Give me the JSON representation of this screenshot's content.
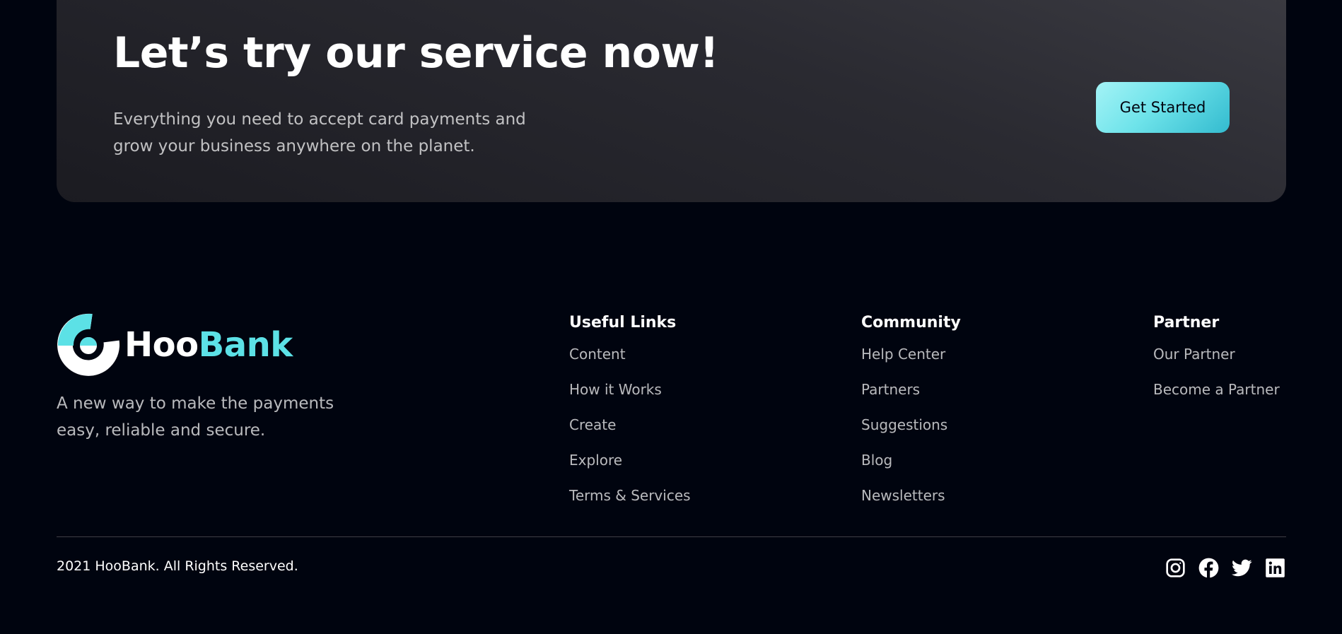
{
  "cta": {
    "title": "Let’s try our service now!",
    "text": "Everything you need to accept card payments and grow your business anywhere on the planet.",
    "button_label": "Get Started"
  },
  "brand": {
    "name_part1": "Hoo",
    "name_part2": "Bank",
    "logo_icon": "hoobank-logo-icon",
    "tagline": "A new way to make the payments easy, reliable and secure."
  },
  "footer_links": [
    {
      "title": "Useful Links",
      "links": [
        "Content",
        "How it Works",
        "Create",
        "Explore",
        "Terms & Services"
      ]
    },
    {
      "title": "Community",
      "links": [
        "Help Center",
        "Partners",
        "Suggestions",
        "Blog",
        "Newsletters"
      ]
    },
    {
      "title": "Partner",
      "links": [
        "Our Partner",
        "Become a Partner"
      ]
    }
  ],
  "bottom": {
    "copyright": "2021 HooBank. All Rights Reserved.",
    "socials": [
      "instagram-icon",
      "facebook-icon",
      "twitter-icon",
      "linkedin-icon"
    ]
  },
  "colors": {
    "background": "#00040f",
    "accent": "#5ce1e6",
    "text_dim": "rgba(255,255,255,0.72)"
  }
}
